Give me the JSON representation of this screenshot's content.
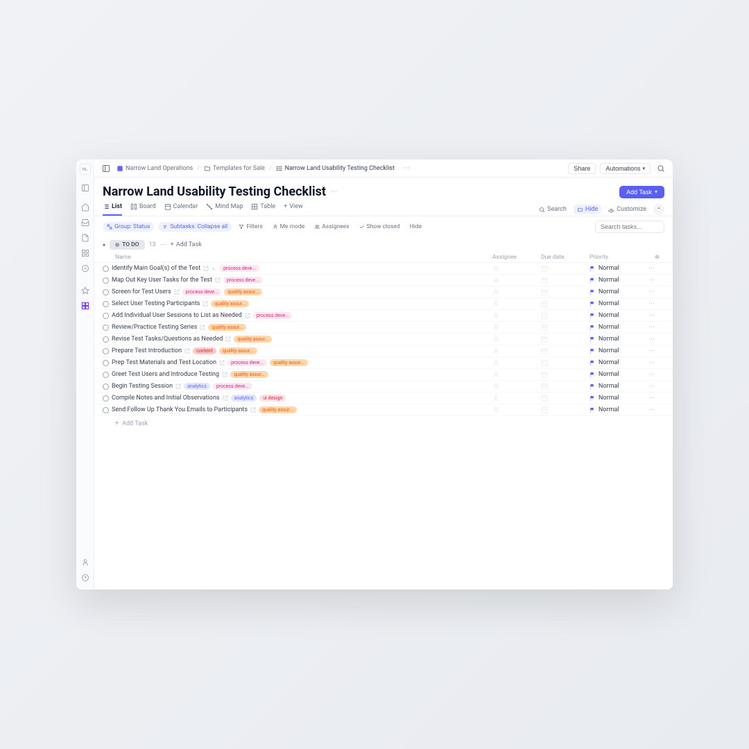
{
  "logo_text": "NL",
  "breadcrumb": {
    "root": "Narrow Land Operations",
    "folder": "Templates for Sale",
    "current": "Narrow Land Usability Testing Checklist"
  },
  "topbar": {
    "share": "Share",
    "automations": "Automations"
  },
  "title": "Narrow Land Usability Testing Checklist",
  "add_task": "Add Task",
  "views": {
    "list": "List",
    "board": "Board",
    "calendar": "Calendar",
    "mindmap": "Mind Map",
    "table": "Table",
    "add_view": "View"
  },
  "view_right": {
    "search": "Search",
    "hide": "Hide",
    "customize": "Customize"
  },
  "toolbar": {
    "group": "Group: Status",
    "subtasks": "Subtasks: Collapse all",
    "filters": "Filters",
    "me_mode": "Me mode",
    "assignees": "Assignees",
    "show_closed": "Show closed",
    "hide": "Hide",
    "search_placeholder": "Search tasks..."
  },
  "group": {
    "status": "TO DO",
    "count": "13",
    "add_task": "Add Task"
  },
  "columns": {
    "name": "Name",
    "assignee": "Assignee",
    "due": "Due date",
    "priority": "Priority"
  },
  "priority_label": "Normal",
  "add_row": "Add Task",
  "tasks": [
    {
      "title": "Identify Main Goal(s) of the Test",
      "tags": [
        "process"
      ],
      "has_sub": true
    },
    {
      "title": "Map Out Key User Tasks for the Test",
      "tags": [
        "process"
      ]
    },
    {
      "title": "Screen for Test Users",
      "tags": [
        "process",
        "quality"
      ]
    },
    {
      "title": "Select User Testing Participants",
      "tags": [
        "quality"
      ]
    },
    {
      "title": "Add Individual User Sessions to List as Needed",
      "tags": [
        "process"
      ]
    },
    {
      "title": "Review/Practice Testing Series",
      "tags": [
        "quality"
      ]
    },
    {
      "title": "Revise Test Tasks/Questions as Needed",
      "tags": [
        "quality"
      ]
    },
    {
      "title": "Prepare Test Introduction",
      "tags": [
        "content",
        "quality"
      ]
    },
    {
      "title": "Prep Test Materials and Test Location",
      "tags": [
        "process",
        "quality"
      ]
    },
    {
      "title": "Greet Test Users and Introduce Testing",
      "tags": [
        "quality"
      ]
    },
    {
      "title": "Begin Testing Session",
      "tags": [
        "analytics",
        "process"
      ]
    },
    {
      "title": "Compile Notes and Initial Observations",
      "tags": [
        "analytics",
        "uidesign"
      ]
    },
    {
      "title": "Send Follow Up Thank You Emails to Participants",
      "tags": [
        "quality"
      ]
    }
  ],
  "tag_labels": {
    "process": "process deve...",
    "quality": "quality assur...",
    "content": "content",
    "analytics": "analytics",
    "uidesign": "ui design"
  }
}
